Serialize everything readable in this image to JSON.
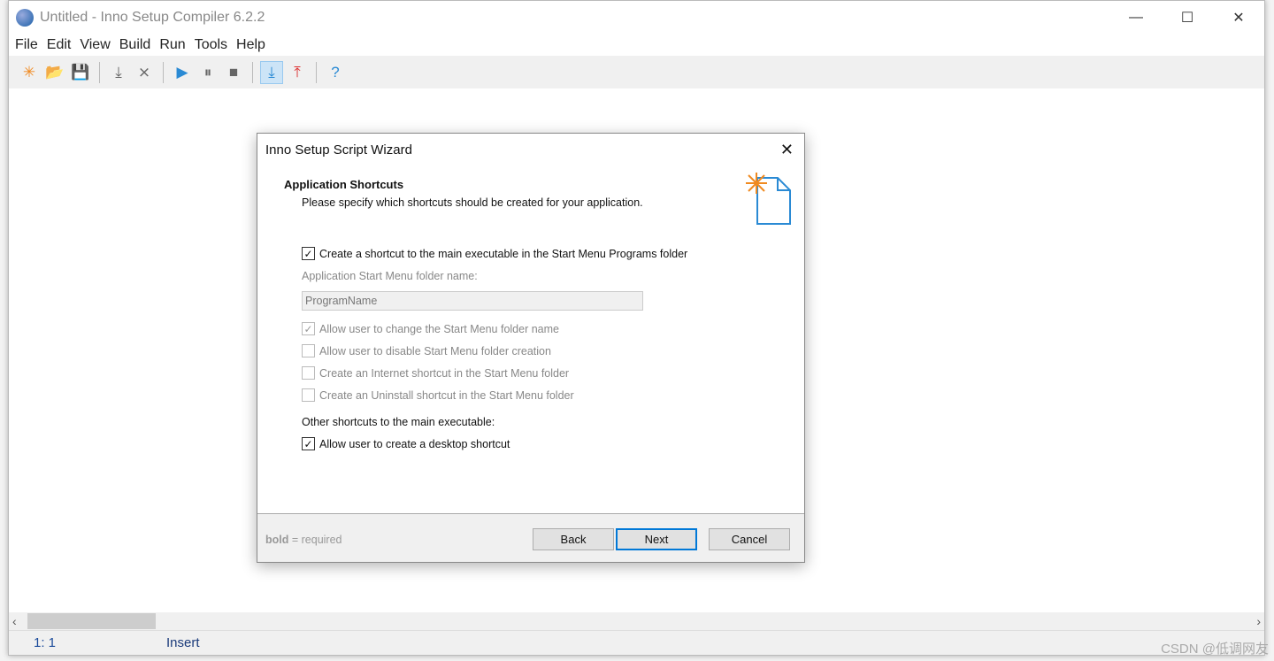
{
  "window": {
    "title": "Untitled - Inno Setup Compiler 6.2.2",
    "minimize": "—",
    "maximize": "☐",
    "close": "✕"
  },
  "menu": [
    "File",
    "Edit",
    "View",
    "Build",
    "Run",
    "Tools",
    "Help"
  ],
  "toolbar": [
    {
      "icon": "new-file-icon",
      "glyph": "✳"
    },
    {
      "icon": "open-folder-icon",
      "glyph": "📂"
    },
    {
      "icon": "save-icon",
      "glyph": "💾"
    },
    {
      "sep": true
    },
    {
      "icon": "compile-icon",
      "glyph": "⤓"
    },
    {
      "icon": "stop-compile-icon",
      "glyph": "⨯"
    },
    {
      "sep": true
    },
    {
      "icon": "run-icon",
      "glyph": "▶"
    },
    {
      "icon": "pause-icon",
      "glyph": "⏸"
    },
    {
      "icon": "stop-icon",
      "glyph": "■"
    },
    {
      "sep": true
    },
    {
      "icon": "target-download-icon",
      "glyph": "⤓",
      "active": true
    },
    {
      "icon": "target-upload-icon",
      "glyph": "⤒"
    },
    {
      "sep": true
    },
    {
      "icon": "help-icon",
      "glyph": "?"
    }
  ],
  "status": {
    "position": "1:  1",
    "mode": "Insert"
  },
  "watermark": "CSDN @低调网友",
  "dialog": {
    "title": "Inno Setup Script Wizard",
    "heading": "Application Shortcuts",
    "subheading": "Please specify which shortcuts should be created for your application.",
    "checkboxes": [
      {
        "label": "Create a shortcut to the main executable in the Start Menu Programs folder",
        "checked": true,
        "disabled": false
      },
      {
        "label": "Allow user to change the Start Menu folder name",
        "checked": true,
        "disabled": true
      },
      {
        "label": "Allow user to disable Start Menu folder creation",
        "checked": false,
        "disabled": true
      },
      {
        "label": "Create an Internet shortcut in the Start Menu folder",
        "checked": false,
        "disabled": true
      },
      {
        "label": "Create an Uninstall shortcut in the Start Menu folder",
        "checked": false,
        "disabled": true
      },
      {
        "label": "Allow user to create a desktop shortcut",
        "checked": true,
        "disabled": false
      }
    ],
    "folder_label": "Application Start Menu folder name:",
    "folder_value": "ProgramName",
    "other_label": "Other shortcuts to the main executable:",
    "footer_bold": "bold",
    "footer_note": " = required",
    "back": "Back",
    "next": "Next",
    "cancel": "Cancel"
  }
}
